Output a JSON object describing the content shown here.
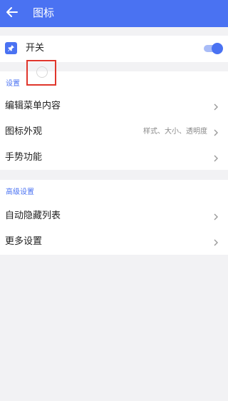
{
  "appbar": {
    "title": "图标",
    "back_icon": "arrow-left-icon"
  },
  "switch_row": {
    "label": "开关",
    "icon": "pin-icon",
    "enabled": true
  },
  "settings": {
    "header": "设置",
    "items": [
      {
        "label": "编辑菜单内容",
        "hint": ""
      },
      {
        "label": "图标外观",
        "hint": "样式、大小、透明度"
      },
      {
        "label": "手势功能",
        "hint": ""
      }
    ]
  },
  "advanced": {
    "header": "高级设置",
    "items": [
      {
        "label": "自动隐藏列表",
        "hint": ""
      },
      {
        "label": "更多设置",
        "hint": ""
      }
    ]
  },
  "colors": {
    "accent": "#4a72f2",
    "background": "#f2f2f4",
    "highlight": "#e0362c"
  }
}
